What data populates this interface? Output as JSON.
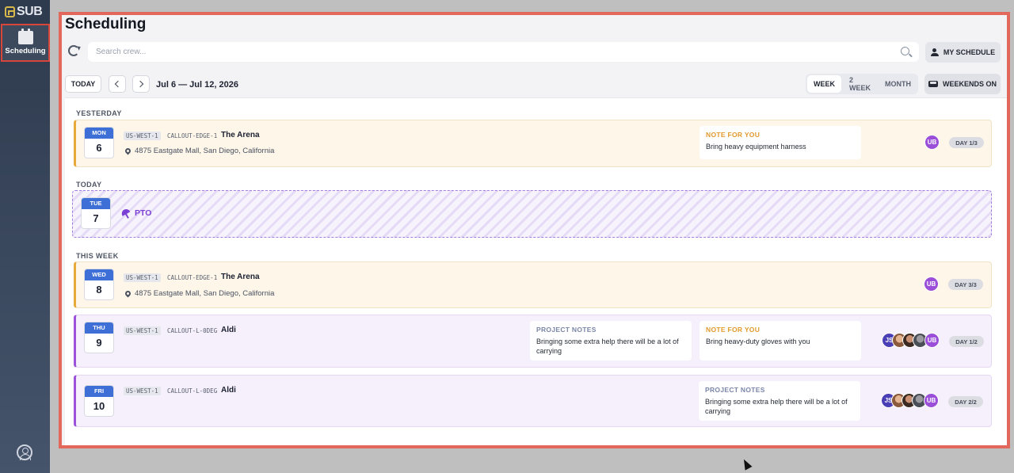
{
  "sidebar": {
    "logo_text": "SUB",
    "nav_scheduling_label": "Scheduling"
  },
  "page": {
    "title": "Scheduling"
  },
  "toolbar": {
    "search_placeholder": "Search crew...",
    "my_schedule_label": "MY SCHEDULE",
    "today_label": "TODAY",
    "date_range": "Jul 6 — Jul 12, 2026",
    "views": [
      "WEEK",
      "2 WEEK",
      "MONTH"
    ],
    "active_view": "WEEK",
    "weekends_label": "WEEKENDS ON"
  },
  "sections": {
    "yesterday": "YESTERDAY",
    "today": "TODAY",
    "this_week": "THIS WEEK"
  },
  "entries": [
    {
      "dow": "MON",
      "day": "6",
      "region": "US-WEST-1",
      "code": "CALLOUT-EDGE-1",
      "job": "The Arena",
      "address": "4875 Eastgate Mall, San Diego, California",
      "note_you_title": "NOTE FOR YOU",
      "note_you_body": "Bring heavy equipment harness",
      "avatars": [
        "UB"
      ],
      "day_pill": "DAY 1/3"
    },
    {
      "dow": "TUE",
      "day": "7",
      "pto_label": "PTO"
    },
    {
      "dow": "WED",
      "day": "8",
      "region": "US-WEST-1",
      "code": "CALLOUT-EDGE-1",
      "job": "The Arena",
      "address": "4875 Eastgate Mall, San Diego, California",
      "avatars": [
        "UB"
      ],
      "day_pill": "DAY 3/3"
    },
    {
      "dow": "THU",
      "day": "9",
      "region": "US-WEST-1",
      "code": "CALLOUT-L-0DEG",
      "job": "Aldi",
      "project_title": "PROJECT NOTES",
      "project_body": "Bringing some extra help there will be a lot of carrying",
      "note_you_title": "NOTE FOR YOU",
      "note_you_body": "Bring heavy-duty gloves with you",
      "avatars": [
        "JS",
        "",
        "",
        "",
        "UB"
      ],
      "day_pill": "DAY 1/2"
    },
    {
      "dow": "FRI",
      "day": "10",
      "region": "US-WEST-1",
      "code": "CALLOUT-L-0DEG",
      "job": "Aldi",
      "project_title": "PROJECT NOTES",
      "project_body": "Bringing some extra help there will be a lot of carrying",
      "avatars": [
        "JS",
        "",
        "",
        "",
        "UB"
      ],
      "day_pill": "DAY 2/2"
    }
  ],
  "colors": {
    "accent_orange": "#e6a93a",
    "accent_purple": "#9b52d9",
    "date_header_blue": "#3d6fd6",
    "highlight_border": "#e2685c"
  }
}
